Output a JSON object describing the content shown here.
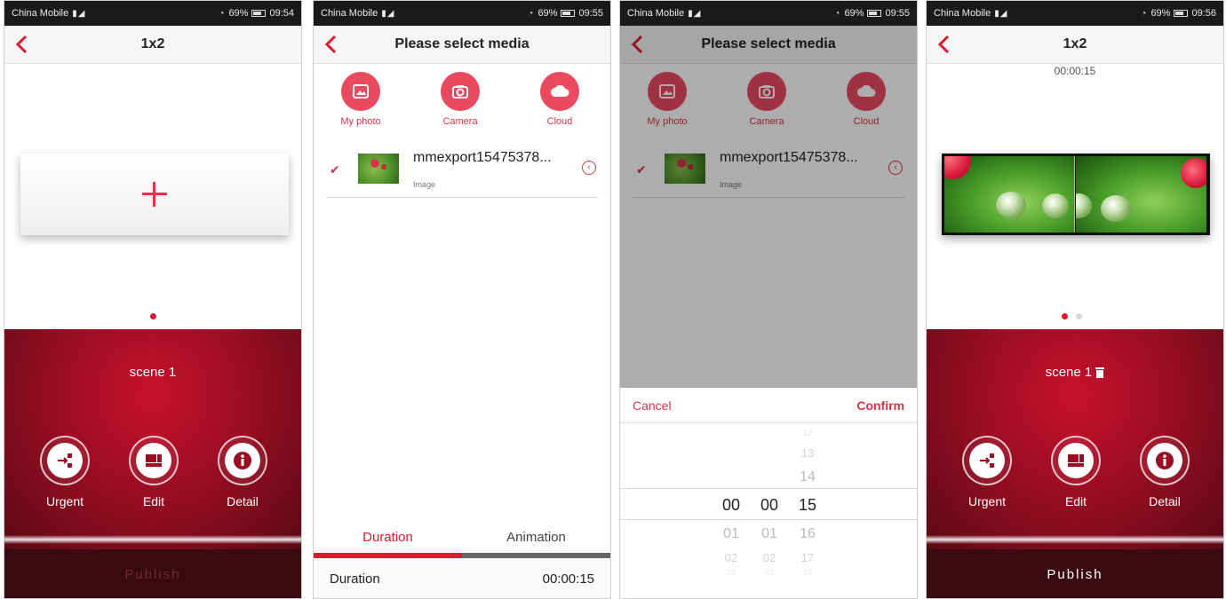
{
  "status_bar": {
    "carrier": "China Mobile",
    "battery": "69%",
    "times": [
      "09:54",
      "09:55",
      "09:55",
      "09:56"
    ]
  },
  "screen1": {
    "title": "1x2",
    "scene_label": "scene 1",
    "actions": {
      "urgent": "Urgent",
      "edit": "Edit",
      "detail": "Detail"
    },
    "publish_label": "Publish"
  },
  "screen2": {
    "title": "Please select media",
    "media_sources": {
      "photo": "My photo",
      "camera": "Camera",
      "cloud": "Cloud"
    },
    "media_item": {
      "name": "mmexport15475378...",
      "type": "Image",
      "checked": true
    },
    "tabs": {
      "duration": "Duration",
      "animation": "Animation"
    },
    "duration_label": "Duration",
    "duration_value": "00:00:15"
  },
  "screen3": {
    "title": "Please select media",
    "media_sources": {
      "photo": "My photo",
      "camera": "Camera",
      "cloud": "Cloud"
    },
    "media_item": {
      "name": "mmexport15475378...",
      "type": "Image"
    },
    "picker": {
      "cancel": "Cancel",
      "confirm": "Confirm",
      "hours": [
        "00",
        "01",
        "02",
        "03"
      ],
      "minutes": [
        "00",
        "01",
        "02",
        "03"
      ],
      "seconds": [
        "12",
        "13",
        "14",
        "15",
        "16",
        "17",
        "18"
      ],
      "selected": {
        "hours": "00",
        "minutes": "00",
        "seconds": "15"
      }
    }
  },
  "screen4": {
    "title": "1x2",
    "timecode": "00:00:15",
    "scene_label": "scene 1",
    "actions": {
      "urgent": "Urgent",
      "edit": "Edit",
      "detail": "Detail"
    },
    "publish_label": "Publish"
  },
  "colors": {
    "accent": "#e0192e",
    "accent_soft": "#e94a5f",
    "panel_red": "#c8102e",
    "publish_disabled_text": "#6e2a35",
    "publish_enabled_text": "#ffffff"
  }
}
